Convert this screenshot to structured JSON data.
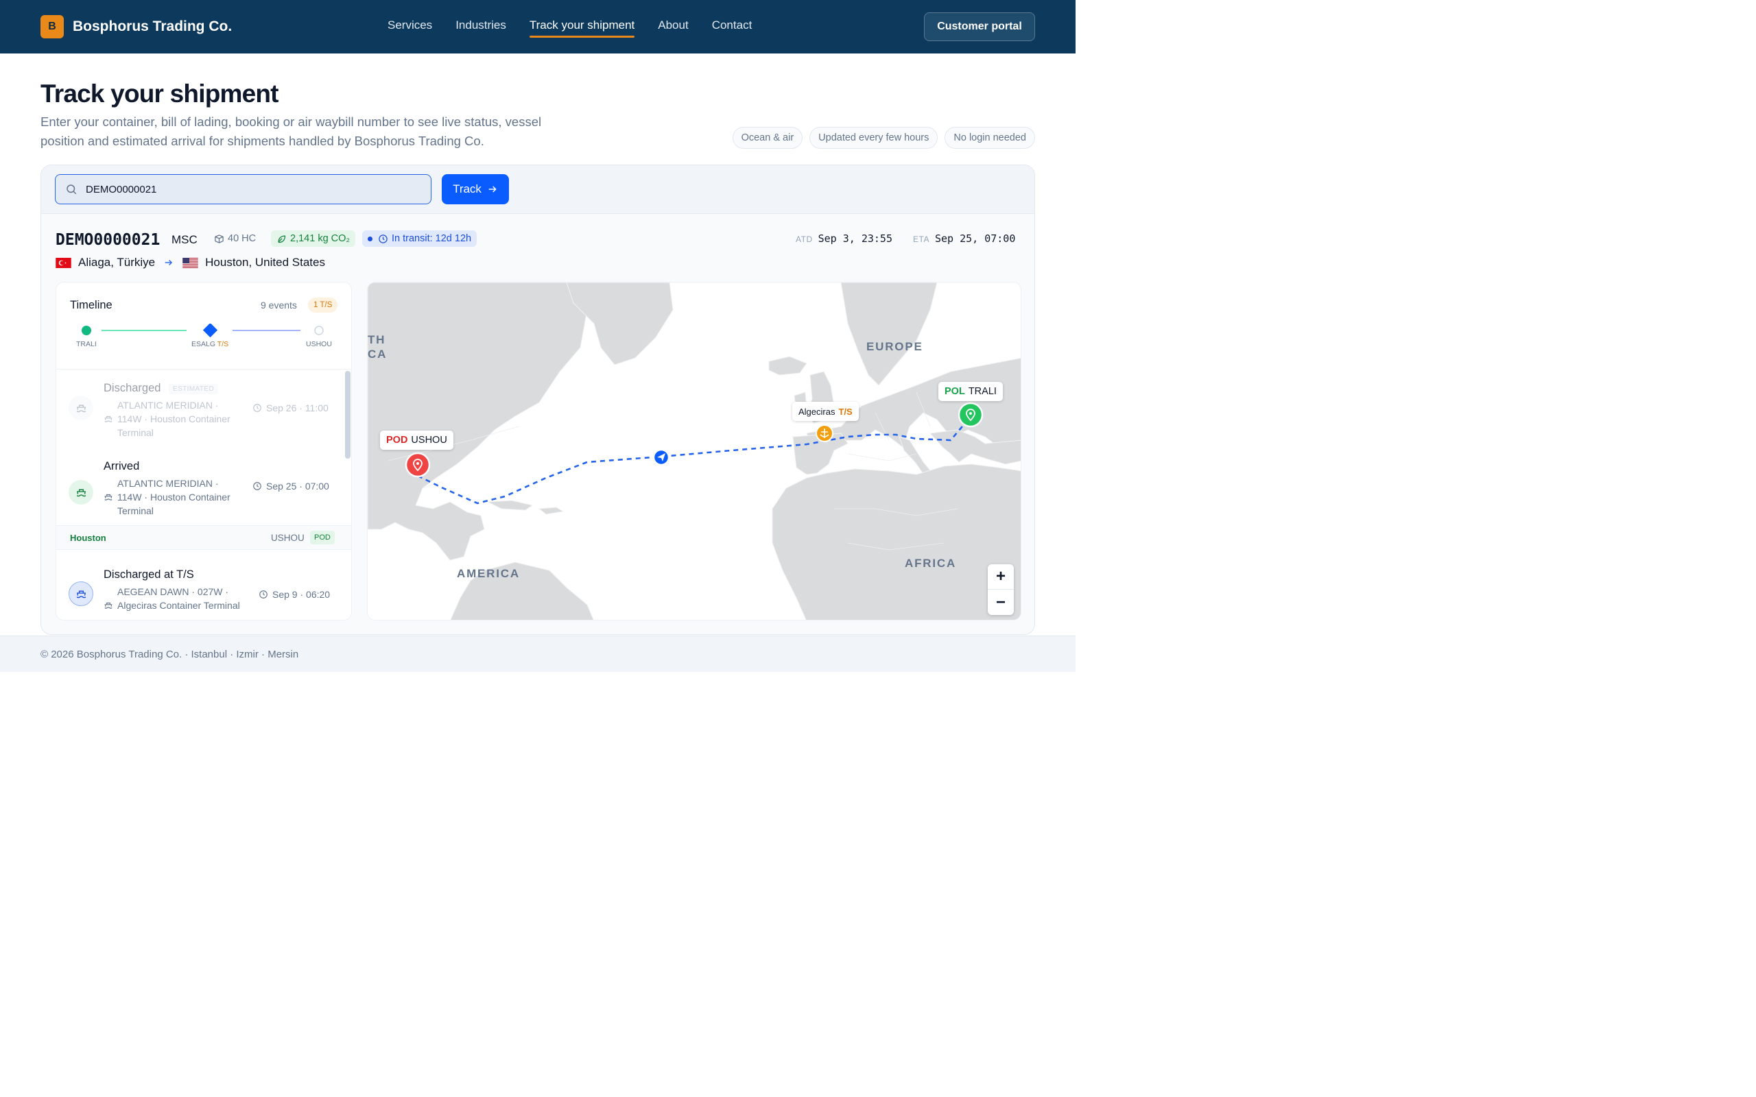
{
  "header": {
    "logo_letter": "B",
    "brand": "Bosphorus Trading Co.",
    "nav": [
      "Services",
      "Industries",
      "Track your shipment",
      "About",
      "Contact"
    ],
    "active_nav": "Track your shipment",
    "portal_button": "Customer portal"
  },
  "hero": {
    "title": "Track your shipment",
    "subtitle": "Enter your container, bill of lading, booking or air waybill number to see live status, vessel position and estimated arrival for shipments handled by Bosphorus Trading Co.",
    "chips": [
      "Ocean & air",
      "Updated every few hours",
      "No login needed"
    ]
  },
  "search": {
    "value": "DEMO0000021",
    "button": "Track"
  },
  "shipment": {
    "id": "DEMO0000021",
    "carrier": "MSC",
    "container": "40 HC",
    "co2": "2,141 kg CO₂",
    "transit": "In transit: 12d 12h",
    "atd_label": "ATD",
    "atd": "Sep 3, 23:55",
    "eta_label": "ETA",
    "eta": "Sep 25, 07:00",
    "origin": "Aliaga, Türkiye",
    "destination": "Houston, United States"
  },
  "timeline": {
    "title": "Timeline",
    "count": "9 events",
    "ts_badge": "1 T/S",
    "progress": [
      {
        "code": "TRALI",
        "tag": ""
      },
      {
        "code": "ESALG",
        "tag": "T/S"
      },
      {
        "code": "USHOU",
        "tag": ""
      }
    ],
    "events": [
      {
        "title": "Discharged",
        "badge": "ESTIMATED",
        "desc": "ATLANTIC MERIDIAN · 114W · Houston Container Terminal",
        "time": "Sep 26 · 11:00"
      },
      {
        "title": "Arrived",
        "badge": "",
        "desc": "ATLANTIC MERIDIAN · 114W · Houston Container Terminal",
        "time": "Sep 25 · 07:00"
      },
      {
        "title": "Discharged at T/S",
        "badge": "",
        "desc": "AEGEAN DAWN · 027W · Algeciras Container Terminal",
        "time": "Sep 9 · 06:20"
      }
    ],
    "port_group": {
      "name": "Houston",
      "code": "USHOU",
      "badge": "POD"
    }
  },
  "map": {
    "labels": [
      "EUROPE",
      "AFRICA",
      "AMERICA",
      "TH",
      "CA"
    ],
    "pod_tag": "POD",
    "pod_code": "USHOU",
    "pol_tag": "POL",
    "pol_code": "TRALI",
    "ts_port": "Algeciras",
    "ts_tag": "T/S",
    "zoom_in": "+",
    "zoom_out": "−"
  },
  "footer": "© 2026 Bosphorus Trading Co. · Istanbul · Izmir · Mersin",
  "colors": {
    "header_bg": "#0d3a5c",
    "accent_orange": "#e8891a",
    "primary_blue": "#0a5cff",
    "pod_red": "#ef4444",
    "pol_green": "#22c55e",
    "ts_orange": "#f59e0b"
  }
}
